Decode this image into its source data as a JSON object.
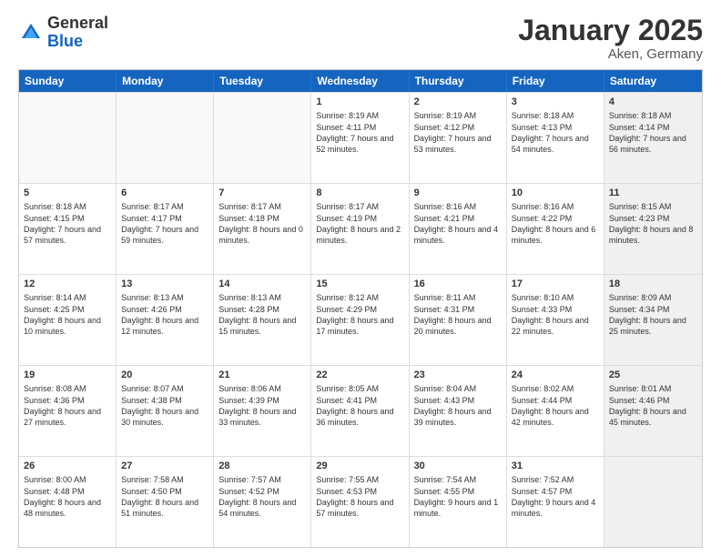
{
  "logo": {
    "general": "General",
    "blue": "Blue"
  },
  "title": "January 2025",
  "location": "Aken, Germany",
  "days": [
    "Sunday",
    "Monday",
    "Tuesday",
    "Wednesday",
    "Thursday",
    "Friday",
    "Saturday"
  ],
  "rows": [
    [
      {
        "day": "",
        "empty": true
      },
      {
        "day": "",
        "empty": true
      },
      {
        "day": "",
        "empty": true
      },
      {
        "day": "1",
        "sunrise": "8:19 AM",
        "sunset": "4:11 PM",
        "daylight": "7 hours and 52 minutes."
      },
      {
        "day": "2",
        "sunrise": "8:19 AM",
        "sunset": "4:12 PM",
        "daylight": "7 hours and 53 minutes."
      },
      {
        "day": "3",
        "sunrise": "8:18 AM",
        "sunset": "4:13 PM",
        "daylight": "7 hours and 54 minutes."
      },
      {
        "day": "4",
        "sunrise": "8:18 AM",
        "sunset": "4:14 PM",
        "daylight": "7 hours and 56 minutes.",
        "shaded": true
      }
    ],
    [
      {
        "day": "5",
        "sunrise": "8:18 AM",
        "sunset": "4:15 PM",
        "daylight": "7 hours and 57 minutes."
      },
      {
        "day": "6",
        "sunrise": "8:17 AM",
        "sunset": "4:17 PM",
        "daylight": "7 hours and 59 minutes."
      },
      {
        "day": "7",
        "sunrise": "8:17 AM",
        "sunset": "4:18 PM",
        "daylight": "8 hours and 0 minutes."
      },
      {
        "day": "8",
        "sunrise": "8:17 AM",
        "sunset": "4:19 PM",
        "daylight": "8 hours and 2 minutes."
      },
      {
        "day": "9",
        "sunrise": "8:16 AM",
        "sunset": "4:21 PM",
        "daylight": "8 hours and 4 minutes."
      },
      {
        "day": "10",
        "sunrise": "8:16 AM",
        "sunset": "4:22 PM",
        "daylight": "8 hours and 6 minutes."
      },
      {
        "day": "11",
        "sunrise": "8:15 AM",
        "sunset": "4:23 PM",
        "daylight": "8 hours and 8 minutes.",
        "shaded": true
      }
    ],
    [
      {
        "day": "12",
        "sunrise": "8:14 AM",
        "sunset": "4:25 PM",
        "daylight": "8 hours and 10 minutes."
      },
      {
        "day": "13",
        "sunrise": "8:13 AM",
        "sunset": "4:26 PM",
        "daylight": "8 hours and 12 minutes."
      },
      {
        "day": "14",
        "sunrise": "8:13 AM",
        "sunset": "4:28 PM",
        "daylight": "8 hours and 15 minutes."
      },
      {
        "day": "15",
        "sunrise": "8:12 AM",
        "sunset": "4:29 PM",
        "daylight": "8 hours and 17 minutes."
      },
      {
        "day": "16",
        "sunrise": "8:11 AM",
        "sunset": "4:31 PM",
        "daylight": "8 hours and 20 minutes."
      },
      {
        "day": "17",
        "sunrise": "8:10 AM",
        "sunset": "4:33 PM",
        "daylight": "8 hours and 22 minutes."
      },
      {
        "day": "18",
        "sunrise": "8:09 AM",
        "sunset": "4:34 PM",
        "daylight": "8 hours and 25 minutes.",
        "shaded": true
      }
    ],
    [
      {
        "day": "19",
        "sunrise": "8:08 AM",
        "sunset": "4:36 PM",
        "daylight": "8 hours and 27 minutes."
      },
      {
        "day": "20",
        "sunrise": "8:07 AM",
        "sunset": "4:38 PM",
        "daylight": "8 hours and 30 minutes."
      },
      {
        "day": "21",
        "sunrise": "8:06 AM",
        "sunset": "4:39 PM",
        "daylight": "8 hours and 33 minutes."
      },
      {
        "day": "22",
        "sunrise": "8:05 AM",
        "sunset": "4:41 PM",
        "daylight": "8 hours and 36 minutes."
      },
      {
        "day": "23",
        "sunrise": "8:04 AM",
        "sunset": "4:43 PM",
        "daylight": "8 hours and 39 minutes."
      },
      {
        "day": "24",
        "sunrise": "8:02 AM",
        "sunset": "4:44 PM",
        "daylight": "8 hours and 42 minutes."
      },
      {
        "day": "25",
        "sunrise": "8:01 AM",
        "sunset": "4:46 PM",
        "daylight": "8 hours and 45 minutes.",
        "shaded": true
      }
    ],
    [
      {
        "day": "26",
        "sunrise": "8:00 AM",
        "sunset": "4:48 PM",
        "daylight": "8 hours and 48 minutes."
      },
      {
        "day": "27",
        "sunrise": "7:58 AM",
        "sunset": "4:50 PM",
        "daylight": "8 hours and 51 minutes."
      },
      {
        "day": "28",
        "sunrise": "7:57 AM",
        "sunset": "4:52 PM",
        "daylight": "8 hours and 54 minutes."
      },
      {
        "day": "29",
        "sunrise": "7:55 AM",
        "sunset": "4:53 PM",
        "daylight": "8 hours and 57 minutes."
      },
      {
        "day": "30",
        "sunrise": "7:54 AM",
        "sunset": "4:55 PM",
        "daylight": "9 hours and 1 minute."
      },
      {
        "day": "31",
        "sunrise": "7:52 AM",
        "sunset": "4:57 PM",
        "daylight": "9 hours and 4 minutes."
      },
      {
        "day": "",
        "empty": true,
        "shaded": true
      }
    ]
  ]
}
